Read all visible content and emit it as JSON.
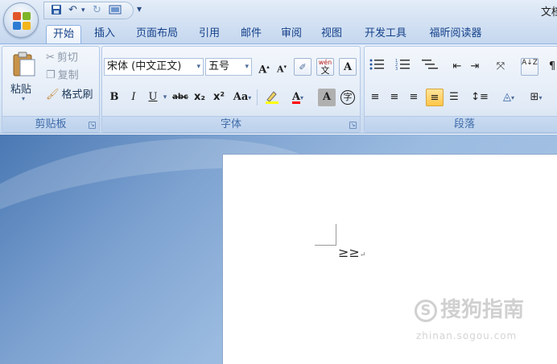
{
  "title_bar": {
    "document_title": "文档",
    "qat": {
      "save_icon": "save-icon",
      "undo_icon": "undo-icon",
      "redo_icon": "redo-icon",
      "print_preview_icon": "print-preview-icon",
      "customize": "▾"
    }
  },
  "tabs": [
    {
      "label": "开始",
      "active": true
    },
    {
      "label": "插入",
      "active": false
    },
    {
      "label": "页面布局",
      "active": false
    },
    {
      "label": "引用",
      "active": false
    },
    {
      "label": "邮件",
      "active": false
    },
    {
      "label": "审阅",
      "active": false
    },
    {
      "label": "视图",
      "active": false
    },
    {
      "label": "开发工具",
      "active": false
    },
    {
      "label": "福昕阅读器",
      "active": false
    }
  ],
  "clipboard": {
    "label": "剪贴板",
    "paste": "粘贴",
    "cut": "剪切",
    "copy": "复制",
    "format_painter": "格式刷"
  },
  "font": {
    "label": "字体",
    "font_name": "宋体 (中文正文)",
    "font_size": "五号",
    "bold": "B",
    "italic": "I",
    "underline": "U",
    "strikethrough": "abc",
    "subscript": "x₂",
    "superscript": "x²",
    "change_case": "Aa",
    "grow_font": "A",
    "shrink_font": "A",
    "phonetic": "文",
    "char_border": "A",
    "char_shading": "A",
    "enclose": "字",
    "wen": "wén"
  },
  "paragraph": {
    "label": "段落",
    "sort": "A↓Z"
  },
  "document": {
    "text": "≥≥",
    "paragraph_mark": "↵"
  },
  "watermark": {
    "text": "搜狗指南",
    "sub": "zhinan.sogou.com"
  },
  "colors": {
    "accent": "#15428b",
    "ribbon_bg": "#dbe7f5",
    "highlight": "#ffff00",
    "font_color": "#ff0000"
  }
}
